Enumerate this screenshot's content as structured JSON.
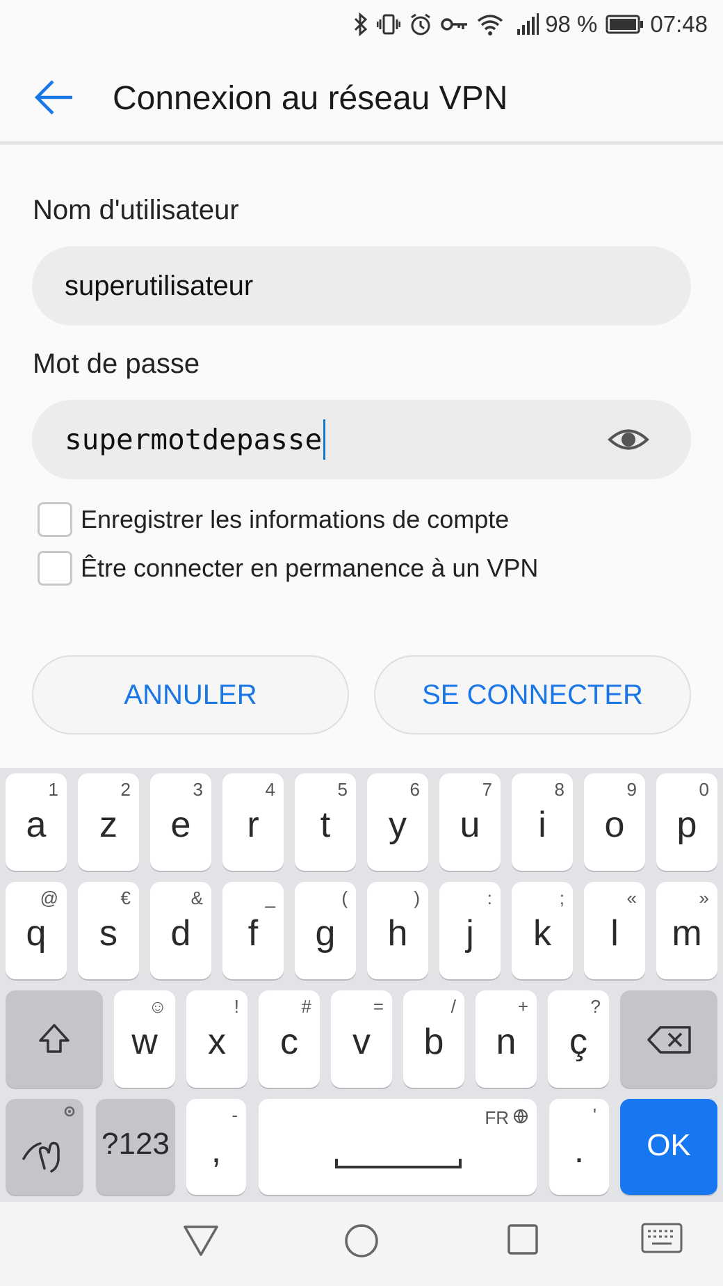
{
  "status_bar": {
    "battery": "98 %",
    "time": "07:48"
  },
  "header": {
    "title": "Connexion au réseau VPN"
  },
  "form": {
    "username_label": "Nom d'utilisateur",
    "username_value": "superutilisateur",
    "password_label": "Mot de passe",
    "password_value": "supermotdepasse",
    "save_info_label": "Enregistrer les informations de compte",
    "always_on_label": "Être connecter en permanence à un VPN"
  },
  "buttons": {
    "cancel": "ANNULER",
    "connect": "SE CONNECTER"
  },
  "keyboard": {
    "row1": [
      {
        "main": "a",
        "sub": "1"
      },
      {
        "main": "z",
        "sub": "2"
      },
      {
        "main": "e",
        "sub": "3"
      },
      {
        "main": "r",
        "sub": "4"
      },
      {
        "main": "t",
        "sub": "5"
      },
      {
        "main": "y",
        "sub": "6"
      },
      {
        "main": "u",
        "sub": "7"
      },
      {
        "main": "i",
        "sub": "8"
      },
      {
        "main": "o",
        "sub": "9"
      },
      {
        "main": "p",
        "sub": "0"
      }
    ],
    "row2": [
      {
        "main": "q",
        "sub": "@"
      },
      {
        "main": "s",
        "sub": "€"
      },
      {
        "main": "d",
        "sub": "&"
      },
      {
        "main": "f",
        "sub": "_"
      },
      {
        "main": "g",
        "sub": "("
      },
      {
        "main": "h",
        "sub": ")"
      },
      {
        "main": "j",
        "sub": ":"
      },
      {
        "main": "k",
        "sub": ";"
      },
      {
        "main": "l",
        "sub": "«"
      },
      {
        "main": "m",
        "sub": "»"
      }
    ],
    "row3": [
      {
        "main": "w",
        "sub": "☺"
      },
      {
        "main": "x",
        "sub": "!"
      },
      {
        "main": "c",
        "sub": "#"
      },
      {
        "main": "v",
        "sub": "="
      },
      {
        "main": "b",
        "sub": "/"
      },
      {
        "main": "n",
        "sub": "+"
      },
      {
        "main": "ç",
        "sub": "?"
      }
    ],
    "symbols_label": "?123",
    "comma_main": ",",
    "comma_sub": "-",
    "space_sub": "FR",
    "period_main": ".",
    "period_sub": "'",
    "ok_label": "OK"
  },
  "icons": {
    "back": "arrow-left-icon",
    "eye": "eye-icon",
    "shift": "shift-icon",
    "backspace": "backspace-icon",
    "swipe": "swipe-gesture-icon",
    "globe": "globe-icon"
  },
  "colors": {
    "accent": "#1976e6",
    "ok_key": "#1677f0"
  }
}
